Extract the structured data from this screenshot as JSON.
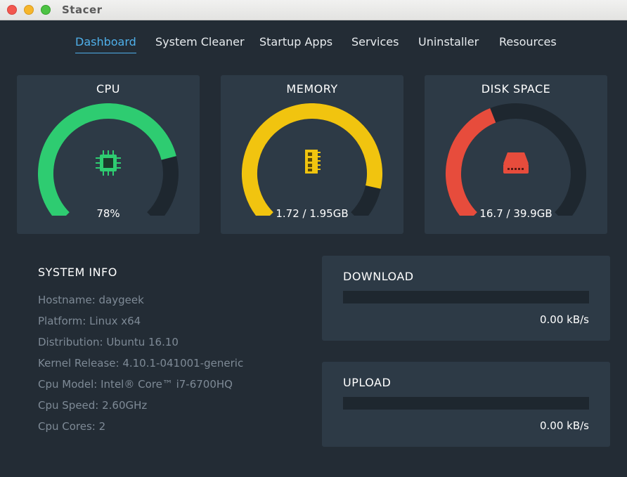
{
  "window": {
    "title": "Stacer"
  },
  "nav": {
    "items": [
      {
        "label": "Dashboard",
        "active": true
      },
      {
        "label": "System Cleaner",
        "active": false
      },
      {
        "label": "Startup Apps",
        "active": false
      },
      {
        "label": "Services",
        "active": false
      },
      {
        "label": "Uninstaller",
        "active": false
      },
      {
        "label": "Resources",
        "active": false
      }
    ]
  },
  "gauges": {
    "cpu": {
      "title": "CPU",
      "value": "78%",
      "fraction": 0.78,
      "color": "#2ecc71",
      "icon": "cpu-chip-icon"
    },
    "memory": {
      "title": "MEMORY",
      "value": "1.72 / 1.95GB",
      "fraction": 0.88,
      "color": "#f1c40f",
      "icon": "ram-module-icon"
    },
    "disk": {
      "title": "DISK SPACE",
      "value": "16.7 / 39.9GB",
      "fraction": 0.42,
      "color": "#e74c3c",
      "icon": "hard-drive-icon"
    }
  },
  "system_info": {
    "title": "SYSTEM INFO",
    "rows": [
      "Hostname: daygeek",
      "Platform: Linux x64",
      "Distribution: Ubuntu 16.10",
      "Kernel Release: 4.10.1-041001-generic",
      "Cpu Model: Intel® Core™ i7-6700HQ",
      "Cpu Speed: 2.60GHz",
      "Cpu Cores: 2"
    ]
  },
  "network": {
    "download": {
      "title": "DOWNLOAD",
      "speed": "0.00 kB/s",
      "fraction": 0
    },
    "upload": {
      "title": "UPLOAD",
      "speed": "0.00 kB/s",
      "fraction": 0
    }
  },
  "colors": {
    "background": "#232c35",
    "card": "#2d3a46",
    "accent": "#4fb0ea",
    "track": "#1e272f"
  }
}
